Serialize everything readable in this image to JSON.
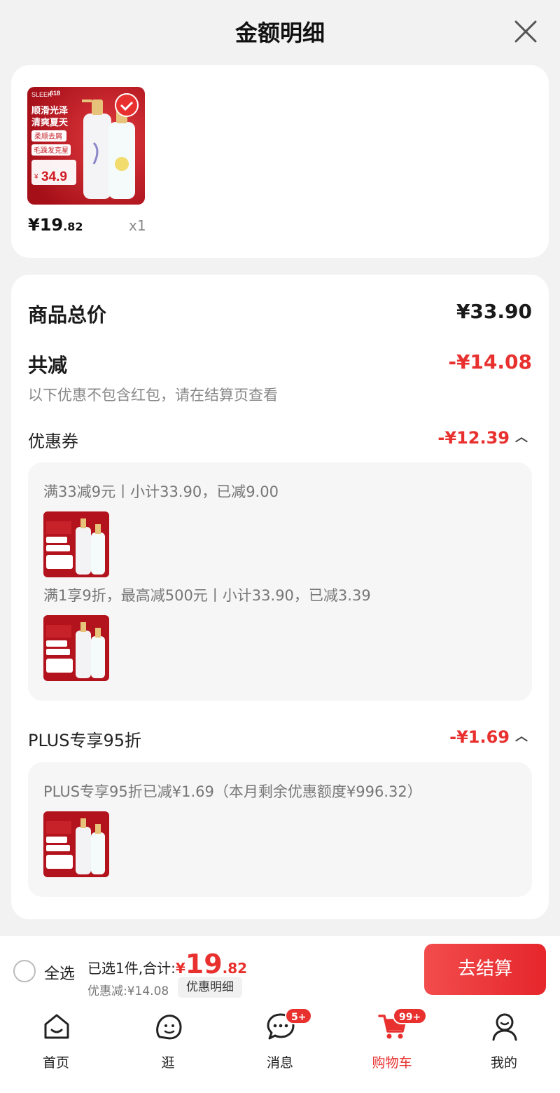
{
  "header": {
    "title": "金额明细"
  },
  "product": {
    "price_main": "¥19",
    "price_decimal": ".82",
    "quantity": "x1",
    "image": {
      "brand": "SLEEK",
      "event": "618",
      "slogan_line1": "顺滑光泽",
      "slogan_line2": "清爽夏天",
      "tag1": "柔顺去屑",
      "tag2": "毛躁发克星",
      "promo_price_symbol": "¥",
      "promo_price": "34.9",
      "colors": {
        "bg": "#b3131c",
        "accent": "#e8312f",
        "gold": "#e7c27a"
      }
    }
  },
  "detail": {
    "total_label": "商品总价",
    "total_value": "¥33.90",
    "reduce_label": "共减",
    "reduce_value": "-¥14.08",
    "hint": "以下优惠不包含红包，请在结算页查看",
    "coupon": {
      "label": "优惠券",
      "value": "-¥12.39",
      "items": [
        "满33减9元丨小计33.90，已减9.00",
        "满1享9折，最高减500元丨小计33.90，已减3.39"
      ]
    },
    "plus": {
      "label": "PLUS专享95折",
      "value": "-¥1.69",
      "items": [
        "PLUS专享95折已减¥1.69（本月剩余优惠额度¥996.32）"
      ]
    }
  },
  "bottom_bar": {
    "select_all": "全选",
    "selected_text": "已选1件,合计:",
    "total_symbol": "¥",
    "total_main": "19",
    "total_decimal": ".82",
    "discount_text": "优惠减:¥14.08",
    "detail_button": "优惠明细",
    "checkout_button": "去结算"
  },
  "tabbar": {
    "tabs": [
      {
        "label": "首页",
        "icon": "home-icon"
      },
      {
        "label": "逛",
        "icon": "browse-icon"
      },
      {
        "label": "消息",
        "icon": "message-icon",
        "badge": "5+"
      },
      {
        "label": "购物车",
        "icon": "cart-icon",
        "badge": "99+",
        "active": true
      },
      {
        "label": "我的",
        "icon": "profile-icon"
      }
    ]
  },
  "colors": {
    "accent": "#e8312f",
    "background": "#f2f2f2"
  }
}
